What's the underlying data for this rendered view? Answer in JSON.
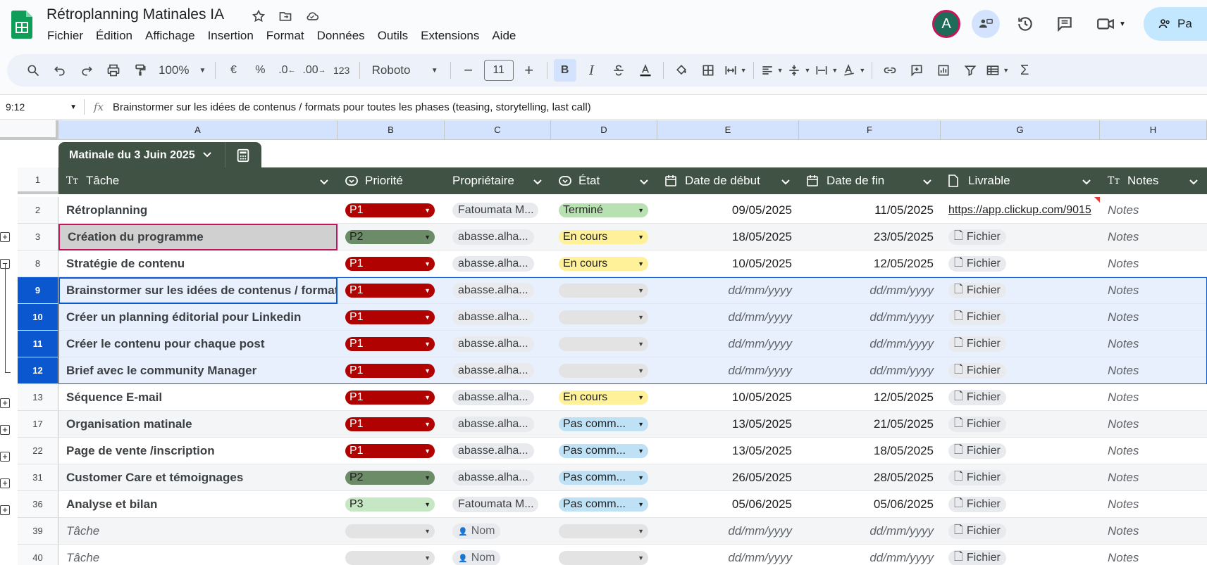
{
  "app": {
    "title": "Rétroplanning Matinales IA",
    "menu": [
      "Fichier",
      "Édition",
      "Affichage",
      "Insertion",
      "Format",
      "Données",
      "Outils",
      "Extensions",
      "Aide"
    ],
    "avatar_letter": "A",
    "share_label": "Pa"
  },
  "toolbar": {
    "zoom": "100%",
    "currency": "€",
    "percent": "%",
    "dec_less": ".0",
    "dec_more": ".00",
    "num_format": "123",
    "font": "Roboto",
    "font_size": "11",
    "bold": "B",
    "italic": "I"
  },
  "formula": {
    "cell_ref": "9:12",
    "fx": "fx",
    "content": "Brainstormer sur les idées de contenus / formats pour toutes les phases (teasing, storytelling, last call)"
  },
  "columns": [
    "A",
    "B",
    "C",
    "D",
    "E",
    "F",
    "G",
    "H"
  ],
  "table": {
    "name": "Matinale du 3 Juin 2025",
    "headers": {
      "task": "Tâche",
      "priority": "Priorité",
      "owner": "Propriétaire",
      "status": "État",
      "start": "Date de début",
      "end": "Date de fin",
      "deliverable": "Livrable",
      "notes": "Notes"
    },
    "header_row_num": "1",
    "rows": [
      {
        "num": "2",
        "task": "Rétroplanning",
        "priority": "P1",
        "owner": "Fatoumata M...",
        "status": "Terminé",
        "start": "09/05/2025",
        "end": "11/05/2025",
        "deliverable": "https://app.clickup.com/9015",
        "notes": "Notes"
      },
      {
        "num": "3",
        "task": "Création du programme",
        "priority": "P2",
        "owner": "abasse.alha...",
        "status": "En cours",
        "start": "18/05/2025",
        "end": "23/05/2025",
        "deliverable": "Fichier",
        "notes": "Notes"
      },
      {
        "num": "8",
        "task": "Stratégie de contenu",
        "priority": "P1",
        "owner": "abasse.alha...",
        "status": "En cours",
        "start": "10/05/2025",
        "end": "12/05/2025",
        "deliverable": "Fichier",
        "notes": "Notes"
      },
      {
        "num": "9",
        "task": "Brainstormer sur les idées de contenus / formats",
        "priority": "P1",
        "owner": "abasse.alha...",
        "status": "",
        "start": "dd/mm/yyyy",
        "end": "dd/mm/yyyy",
        "deliverable": "Fichier",
        "notes": "Notes"
      },
      {
        "num": "10",
        "task": "Créer un planning éditorial pour Linkedin",
        "priority": "P1",
        "owner": "abasse.alha...",
        "status": "",
        "start": "dd/mm/yyyy",
        "end": "dd/mm/yyyy",
        "deliverable": "Fichier",
        "notes": "Notes"
      },
      {
        "num": "11",
        "task": "Créer le contenu pour chaque post",
        "priority": "P1",
        "owner": "abasse.alha...",
        "status": "",
        "start": "dd/mm/yyyy",
        "end": "dd/mm/yyyy",
        "deliverable": "Fichier",
        "notes": "Notes"
      },
      {
        "num": "12",
        "task": "Brief avec le community Manager",
        "priority": "P1",
        "owner": "abasse.alha...",
        "status": "",
        "start": "dd/mm/yyyy",
        "end": "dd/mm/yyyy",
        "deliverable": "Fichier",
        "notes": "Notes"
      },
      {
        "num": "13",
        "task": "Séquence E-mail",
        "priority": "P1",
        "owner": "abasse.alha...",
        "status": "En cours",
        "start": "10/05/2025",
        "end": "12/05/2025",
        "deliverable": "Fichier",
        "notes": "Notes"
      },
      {
        "num": "17",
        "task": "Organisation matinale",
        "priority": "P1",
        "owner": "abasse.alha...",
        "status": "Pas comm...",
        "start": "13/05/2025",
        "end": "21/05/2025",
        "deliverable": "Fichier",
        "notes": "Notes"
      },
      {
        "num": "22",
        "task": "Page de vente /inscription",
        "priority": "P1",
        "owner": "abasse.alha...",
        "status": "Pas comm...",
        "start": "13/05/2025",
        "end": "18/05/2025",
        "deliverable": "Fichier",
        "notes": "Notes"
      },
      {
        "num": "31",
        "task": "Customer Care et témoignages",
        "priority": "P2",
        "owner": "abasse.alha...",
        "status": "Pas comm...",
        "start": "26/05/2025",
        "end": "28/05/2025",
        "deliverable": "Fichier",
        "notes": "Notes"
      },
      {
        "num": "36",
        "task": "Analyse et bilan",
        "priority": "P3",
        "owner": "Fatoumata M...",
        "status": "Pas comm...",
        "start": "05/06/2025",
        "end": "05/06/2025",
        "deliverable": "Fichier",
        "notes": "Notes"
      },
      {
        "num": "39",
        "task": "Tâche",
        "priority": "",
        "owner": "Nom",
        "status": "",
        "start": "dd/mm/yyyy",
        "end": "dd/mm/yyyy",
        "deliverable": "Fichier",
        "notes": "Notes"
      },
      {
        "num": "40",
        "task": "Tâche",
        "priority": "",
        "owner": "Nom",
        "status": "",
        "start": "dd/mm/yyyy",
        "end": "dd/mm/yyyy",
        "deliverable": "Fichier",
        "notes": "Notes"
      }
    ]
  },
  "colors": {
    "header_green": "#3f5244",
    "p1": "#b10202",
    "p2": "#6b8c66",
    "p3": "#c6e7c3",
    "done": "#b7e1b0",
    "in_progress": "#fff199",
    "not_started": "#bfe1f6",
    "selection": "#0b57d0"
  }
}
